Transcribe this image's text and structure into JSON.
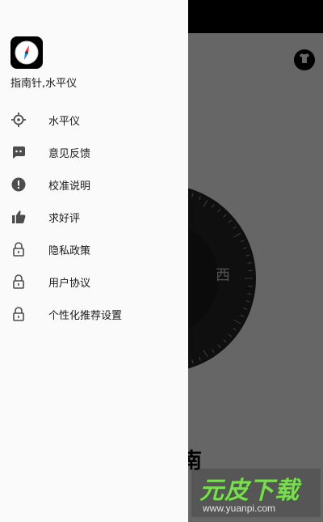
{
  "drawer": {
    "app_name": "指南针,水平仪",
    "items": [
      {
        "label": "水平仪",
        "icon": "crosshair-icon"
      },
      {
        "label": "意见反馈",
        "icon": "feedback-icon"
      },
      {
        "label": "校准说明",
        "icon": "alert-icon"
      },
      {
        "label": "求好评",
        "icon": "thumbs-up-icon"
      },
      {
        "label": "隐私政策",
        "icon": "lock-icon"
      },
      {
        "label": "用户协议",
        "icon": "lock-icon"
      },
      {
        "label": "个性化推荐设置",
        "icon": "lock-icon"
      }
    ]
  },
  "background": {
    "compass_letter": "西",
    "bottom_heading": "南"
  },
  "watermark": {
    "title": "元皮下载",
    "url": "www.yuanpi.com"
  },
  "colors": {
    "drawer_bg": "#fafafa",
    "icon": "#4d4d4d",
    "watermark_green": "#7ed957"
  }
}
